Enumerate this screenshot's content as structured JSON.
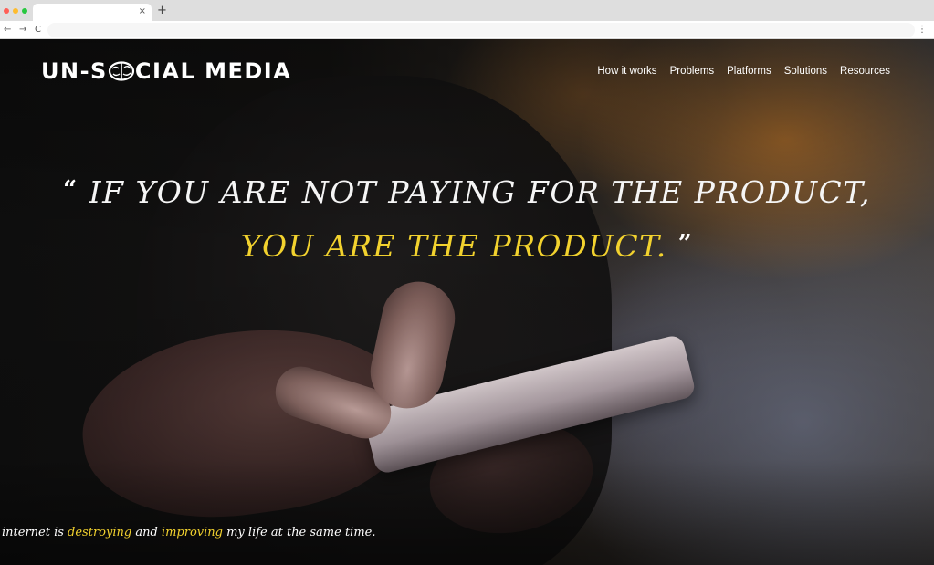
{
  "browser": {
    "tab_close": "×",
    "new_tab": "+",
    "back": "←",
    "forward": "→",
    "reload": "C",
    "menu": "⋮"
  },
  "site": {
    "logo_before": "UN-S",
    "logo_after": "CIAL MEDIA",
    "logo_icon": "brain-icon",
    "nav": [
      "How it works",
      "Problems",
      "Platforms",
      "Solutions",
      "Resources"
    ]
  },
  "hero": {
    "quote_open": "“",
    "quote_line1": "IF YOU ARE NOT PAYING FOR THE PRODUCT,",
    "quote_line2": "YOU ARE THE PRODUCT.",
    "quote_close": "”",
    "tagline": {
      "part1": "internet is ",
      "highlight1": "destroying",
      "part2": " and ",
      "highlight2": "improving",
      "part3": " my life at the same time."
    }
  },
  "colors": {
    "accent_yellow": "#f2d22e",
    "text_white": "#ffffff",
    "background_dark": "#1a1712"
  }
}
